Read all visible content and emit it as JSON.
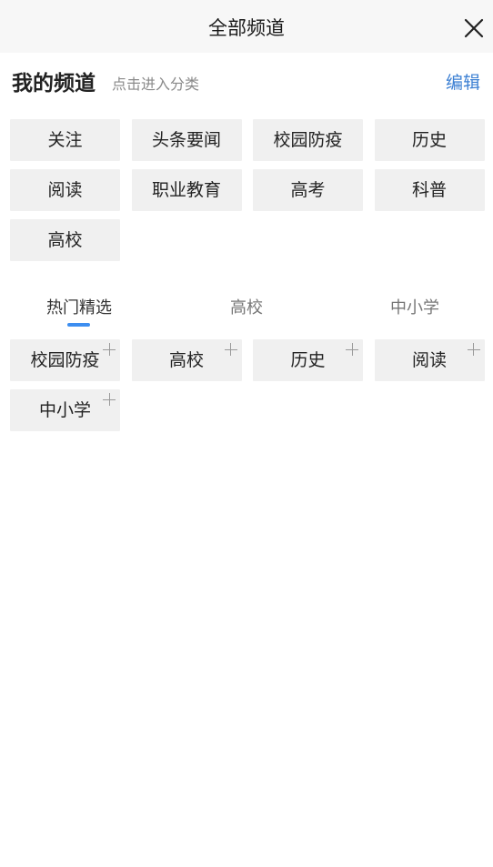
{
  "header": {
    "title": "全部频道",
    "close_icon": "close-icon"
  },
  "my_channels": {
    "title": "我的频道",
    "hint": "点击进入分类",
    "edit_label": "编辑",
    "items": [
      "关注",
      "头条要闻",
      "校园防疫",
      "历史",
      "阅读",
      "职业教育",
      "高考",
      "科普",
      "高校"
    ]
  },
  "recommend": {
    "tabs": [
      "热门精选",
      "高校",
      "中小学"
    ],
    "active_tab": "热门精选",
    "items": [
      "校园防疫",
      "高校",
      "历史",
      "阅读",
      "中小学"
    ],
    "add_icon": "plus-icon"
  },
  "colors": {
    "accent": "#3b7fd3",
    "indicator": "#3d8ef0",
    "chip_bg": "#f0f0f0",
    "header_bg": "#f7f7f7"
  }
}
